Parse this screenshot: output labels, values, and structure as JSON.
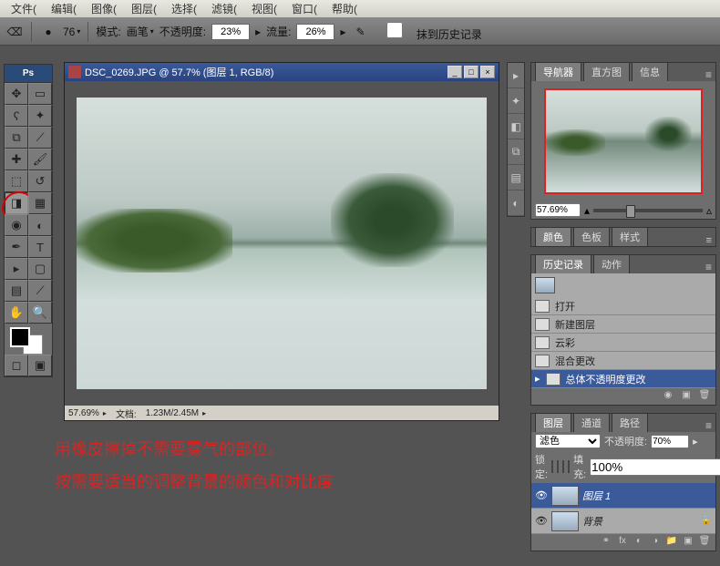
{
  "menu": {
    "file": "文件(",
    "edit": "编辑(",
    "image": "图像(",
    "layer": "图层(",
    "select": "选择(",
    "filter": "滤镜(",
    "view": "视图(",
    "window": "窗口(",
    "help": "帮助("
  },
  "options": {
    "brush_size": "76",
    "mode_label": "模式:",
    "mode_value": "画笔",
    "opacity_label": "不透明度:",
    "opacity_value": "23%",
    "flow_label": "流量:",
    "flow_value": "26%",
    "erase_history": "抹到历史记录"
  },
  "doc": {
    "title": "DSC_0269.JPG @ 57.7% (图层 1, RGB/8)",
    "zoom": "57.69%",
    "docinfo_label": "文档:",
    "docinfo_value": "1.23M/2.45M"
  },
  "navigator": {
    "tabs": {
      "nav": "导航器",
      "histo": "直方图",
      "info": "信息"
    },
    "zoom": "57.69%"
  },
  "colors": {
    "tabs": {
      "color": "颜色",
      "swatches": "色板",
      "styles": "样式"
    }
  },
  "history": {
    "tabs": {
      "history": "历史记录",
      "actions": "动作"
    },
    "items": [
      "打开",
      "新建图层",
      "云彩",
      "混合更改",
      "总体不透明度更改"
    ]
  },
  "layers": {
    "tabs": {
      "layers": "图层",
      "channels": "通道",
      "paths": "路径"
    },
    "blend_mode": "滤色",
    "opacity_label": "不透明度:",
    "opacity": "70%",
    "lock_label": "锁定:",
    "fill_label": "填充:",
    "fill": "100%",
    "items": [
      {
        "name": "图层 1"
      },
      {
        "name": "背景"
      }
    ]
  },
  "annotation": {
    "line1": "用橡皮擦掉不需要雾气的部位。",
    "line2": "按需要适当的调整背景的颜色和对比度"
  },
  "icons": {
    "min": "_",
    "max": "□",
    "close": "×"
  }
}
